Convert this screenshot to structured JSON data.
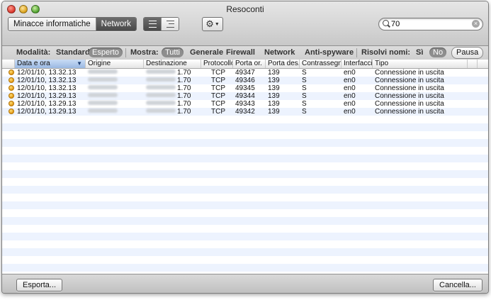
{
  "window": {
    "title": "Resoconti"
  },
  "mode_tabs": [
    {
      "label": "Minacce informatiche",
      "active": false
    },
    {
      "label": "Network",
      "active": true
    }
  ],
  "search": {
    "value": "70"
  },
  "filter": {
    "modalita_label": "Modalità:",
    "standard": "Standard",
    "esperto": "Esperto",
    "mostra_label": "Mostra:",
    "tutti": "Tutti",
    "generale": "Generale",
    "firewall": "Firewall",
    "network": "Network",
    "antispyware": "Anti-spyware",
    "risolvi_label": "Risolvi nomi:",
    "si": "Sì",
    "no": "No",
    "pausa": "Pausa"
  },
  "table": {
    "columns": [
      "Data e ora",
      "Origine",
      "Destinazione",
      "Protocollo",
      "Porta or.",
      "Porta des.",
      "Contrassegni",
      "Interfaccia",
      "Tipo"
    ],
    "rows": [
      {
        "datetime": "12/01/10, 13.32.13",
        "dest_suffix": "1.70",
        "protocol": "TCP",
        "src_port": "49347",
        "dst_port": "139",
        "flags": "S",
        "iface": "en0",
        "type": "Connessione in uscita"
      },
      {
        "datetime": "12/01/10, 13.32.13",
        "dest_suffix": "1.70",
        "protocol": "TCP",
        "src_port": "49346",
        "dst_port": "139",
        "flags": "S",
        "iface": "en0",
        "type": "Connessione in uscita"
      },
      {
        "datetime": "12/01/10, 13.32.13",
        "dest_suffix": "1.70",
        "protocol": "TCP",
        "src_port": "49345",
        "dst_port": "139",
        "flags": "S",
        "iface": "en0",
        "type": "Connessione in uscita"
      },
      {
        "datetime": "12/01/10, 13.29.13",
        "dest_suffix": "1.70",
        "protocol": "TCP",
        "src_port": "49344",
        "dst_port": "139",
        "flags": "S",
        "iface": "en0",
        "type": "Connessione in uscita"
      },
      {
        "datetime": "12/01/10, 13.29.13",
        "dest_suffix": "1.70",
        "protocol": "TCP",
        "src_port": "49343",
        "dst_port": "139",
        "flags": "S",
        "iface": "en0",
        "type": "Connessione in uscita"
      },
      {
        "datetime": "12/01/10, 13.29.13",
        "dest_suffix": "1.70",
        "protocol": "TCP",
        "src_port": "49342",
        "dst_port": "139",
        "flags": "S",
        "iface": "en0",
        "type": "Connessione in uscita"
      }
    ]
  },
  "buttons": {
    "export": "Esporta...",
    "cancel": "Cancella..."
  },
  "icons": {
    "row_status": "warning-dot-icon",
    "settings": "gear-icon",
    "search": "search-icon",
    "clear": "clear-icon"
  },
  "colors": {
    "row_stripe": "#edf3fe",
    "sorted_header": "#9ab9e3",
    "status_dot": "#e0930c",
    "active_segment": "#4a4a4a"
  }
}
